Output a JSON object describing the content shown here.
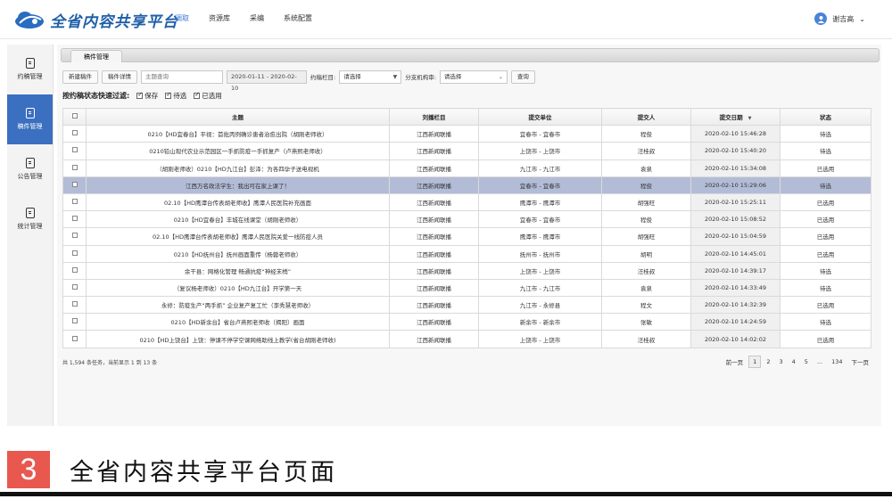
{
  "app": {
    "logo_text": "全省内容共享平台",
    "nav": [
      "调取",
      "资源库",
      "采编",
      "系统配置"
    ],
    "user_name": "谢吉高",
    "user_avatar_letter": "谢"
  },
  "sidebar": {
    "items": [
      {
        "label": "约稿管理"
      },
      {
        "label": "稿件管理"
      },
      {
        "label": "公告管理"
      },
      {
        "label": "统计管理"
      }
    ]
  },
  "tab": {
    "label": "稿件管理"
  },
  "toolbar": {
    "new_label": "新建稿件",
    "detail_label": "稿件详情",
    "search_placeholder": "主题查询",
    "date_range": "2020-01-11 - 2020-02-10",
    "column_label": "约稿栏目:",
    "column_value": "请选择",
    "org_label": "分支机构审:",
    "org_value": "请选择",
    "query_label": "查询"
  },
  "filter": {
    "title": "按约稿状态快速过滤:",
    "options": [
      "保存",
      "待选",
      "已选用"
    ]
  },
  "table": {
    "headers": [
      "主题",
      "刘播栏目",
      "提交单位",
      "提交人",
      "提交日期",
      "状态"
    ],
    "rows": [
      {
        "title": "0210【HD宜春台】平视：首批丙例确诊患者治愈出院（胡刚老师收）",
        "col": "江西新闻联播",
        "unit": "宜春市 - 宜春市",
        "person": "程俊",
        "date": "2020-02-10 15:46:28",
        "status": "待选"
      },
      {
        "title": "0210铅山现代农业示范园区一手抓防疫一手抓复产（卢燕熙老师收）",
        "col": "江西新闻联播",
        "unit": "上饶市 - 上饶市",
        "person": "汪桂叔",
        "date": "2020-02-10 15:40:20",
        "status": "待选"
      },
      {
        "title": "（胡刚老师收）0210【HD九江台】彭泽：为各四孕子送电视机",
        "col": "江西新闻联播",
        "unit": "九江市 - 九江市",
        "person": "袁泉",
        "date": "2020-02-10 15:34:08",
        "status": "已选用"
      },
      {
        "title": "江西万名政法学生：我出可在家上课了！",
        "col": "江西新闻联播",
        "unit": "宜春市 - 宜春市",
        "person": "程俊",
        "date": "2020-02-10 15:29:06",
        "status": "待选"
      },
      {
        "title": "02.10【HD鹰潭台传表胡老师收】鹰潭人民医院补充画面",
        "col": "江西新闻联播",
        "unit": "鹰潭市 - 鹰潭市",
        "person": "胡强旺",
        "date": "2020-02-10 15:25:11",
        "status": "已选用"
      },
      {
        "title": "0210【HD宜春台】丰城在线课堂（胡刚老师收）",
        "col": "江西新闻联播",
        "unit": "宜春市 - 宜春市",
        "person": "程俊",
        "date": "2020-02-10 15:08:52",
        "status": "已选用"
      },
      {
        "title": "02.10【HD鹰潭台传表胡老师收】鹰潭人民医院关爱一线防疫人员",
        "col": "江西新闻联播",
        "unit": "鹰潭市 - 鹰潭市",
        "person": "胡强旺",
        "date": "2020-02-10 15:04:59",
        "status": "已选用"
      },
      {
        "title": "0210【HD抚州台】抚州画面重传（杨蓉老师收）",
        "col": "江西新闻联播",
        "unit": "抚州市 - 抚州市",
        "person": "胡明",
        "date": "2020-02-10 14:45:01",
        "status": "已选用"
      },
      {
        "title": "余干县：网格化管理 畅通抗疫“神经末梢”",
        "col": "江西新闻联播",
        "unit": "上饶市 - 上饶市",
        "person": "汪桂叔",
        "date": "2020-02-10 14:39:17",
        "status": "待选"
      },
      {
        "title": "（复议杨老师收）0210【HD九江台】开学第一天",
        "col": "江西新闻联播",
        "unit": "九江市 - 九江市",
        "person": "袁泉",
        "date": "2020-02-10 14:33:49",
        "status": "待选"
      },
      {
        "title": "永修：防疫生产“两手抓” 企业复产复工忙（李秀慧老师收）",
        "col": "江西新闻联播",
        "unit": "九江市 - 永修县",
        "person": "程文",
        "date": "2020-02-10 14:32:39",
        "status": "已选用"
      },
      {
        "title": "0210【HD新余台】省台卢燕熙老师收（揭阳）画面",
        "col": "江西新闻联播",
        "unit": "新余市 - 新余市",
        "person": "张敏",
        "date": "2020-02-10 14:24:59",
        "status": "待选"
      },
      {
        "title": "0210【HD上饶台】上饶：停课不停学空课网络助线上教学(省台胡刚老师收)",
        "col": "江西新闻联播",
        "unit": "上饶市 - 上饶市",
        "person": "汪桂叔",
        "date": "2020-02-10 14:02:02",
        "status": "已选用"
      }
    ],
    "selected_row": 3
  },
  "footer": {
    "summary": "共 1,594 条任务，当前显示 1 到 13 条",
    "prev": "前一页",
    "pages": [
      "1",
      "2",
      "3",
      "4",
      "5",
      "...",
      "134"
    ],
    "next": "下一页"
  },
  "caption": {
    "number": "3",
    "text": "全省内容共享平台页面"
  },
  "colors": {
    "accent": "#3b6fc0",
    "caption_badge": "#e8584f",
    "selected_row": "#b3bcd6"
  }
}
